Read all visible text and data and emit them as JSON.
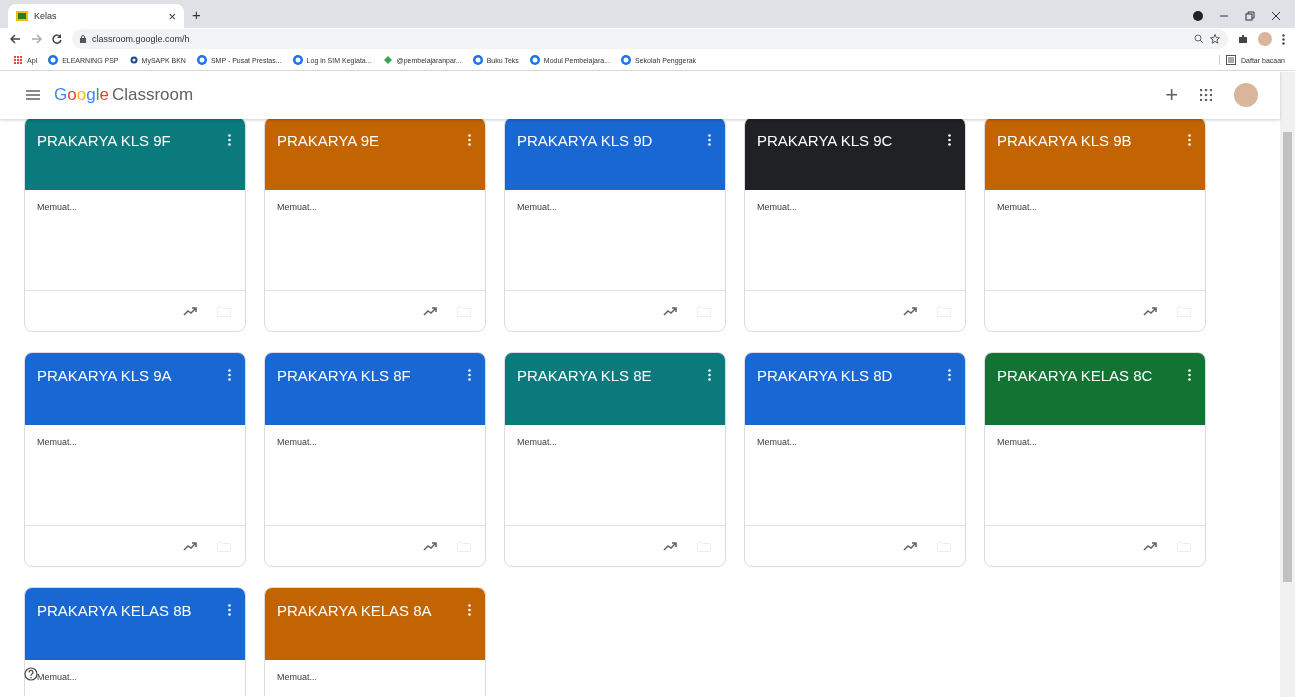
{
  "browser": {
    "tab": {
      "title": "Kelas",
      "close": "×"
    },
    "new_tab": "+",
    "address": "classroom.google.com/h",
    "bookmarks": [
      {
        "label": "Apl",
        "kind": "apps"
      },
      {
        "label": "ELEARNING PSP",
        "kind": "globe"
      },
      {
        "label": "MySAPK BKN",
        "kind": "dot"
      },
      {
        "label": "SMP - Pusat Prestas...",
        "kind": "globe"
      },
      {
        "label": "Log in SIM Kegiata...",
        "kind": "globe"
      },
      {
        "label": "@pembelajaranpar...",
        "kind": "leaf"
      },
      {
        "label": "Buku Teks",
        "kind": "globe"
      },
      {
        "label": "Modul Pembelajara...",
        "kind": "globe"
      },
      {
        "label": "Sekolah Penggerak",
        "kind": "globe"
      }
    ],
    "reading_list": "Daftar bacaan"
  },
  "app": {
    "logo": "Google",
    "name": "Classroom",
    "add": "+"
  },
  "classes": [
    {
      "name": "PRAKARYA KLS 9F",
      "status": "Memuat...",
      "color": "#0b7a7d"
    },
    {
      "name": "PRAKARYA 9E",
      "status": "Memuat...",
      "color": "#c26401"
    },
    {
      "name": "PRAKARYA KLS 9D",
      "status": "Memuat...",
      "color": "#1967d2"
    },
    {
      "name": "PRAKARYA KLS 9C",
      "status": "Memuat...",
      "color": "#202124"
    },
    {
      "name": "PRAKARYA KLS 9B",
      "status": "Memuat...",
      "color": "#c26401"
    },
    {
      "name": "PRAKARYA KLS 9A",
      "status": "Memuat...",
      "color": "#1967d2"
    },
    {
      "name": "PRAKARYA KLS 8F",
      "status": "Memuat...",
      "color": "#1967d2"
    },
    {
      "name": "PRAKARYA KLS 8E",
      "status": "Memuat...",
      "color": "#0b7a7d"
    },
    {
      "name": "PRAKARYA KLS 8D",
      "status": "Memuat...",
      "color": "#1967d2"
    },
    {
      "name": "PRAKARYA KELAS 8C",
      "status": "Memuat...",
      "color": "#137333"
    },
    {
      "name": "PRAKARYA KELAS 8B",
      "status": "Memuat...",
      "color": "#1967d2"
    },
    {
      "name": "PRAKARYA KELAS 8A",
      "status": "Memuat...",
      "color": "#c26401"
    }
  ]
}
